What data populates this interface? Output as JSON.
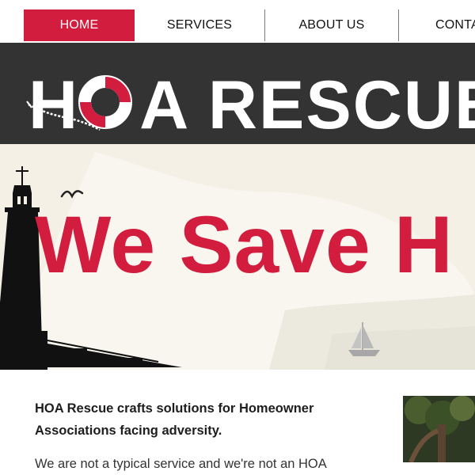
{
  "nav": {
    "items": [
      {
        "label": "HOME",
        "active": true
      },
      {
        "label": "SERVICES",
        "active": false
      },
      {
        "label": "ABOUT US",
        "active": false
      },
      {
        "label": "CONTA",
        "active": false
      }
    ],
    "accent_color": "#d21d3f"
  },
  "header": {
    "logo_text_left": "H",
    "logo_text_right": "A RESCUE",
    "background_color": "#333333"
  },
  "hero": {
    "headline": "We Save H",
    "headline_color": "#d21d3f",
    "illustration": [
      "lighthouse-icon",
      "seagull-icon",
      "sailboat-icon"
    ]
  },
  "content": {
    "intro": "HOA Rescue crafts solutions for Homeowner Associations facing adversity.",
    "body": "We are not a typical service and we're not an HOA"
  },
  "photo": {
    "icon": "tree-photo"
  }
}
